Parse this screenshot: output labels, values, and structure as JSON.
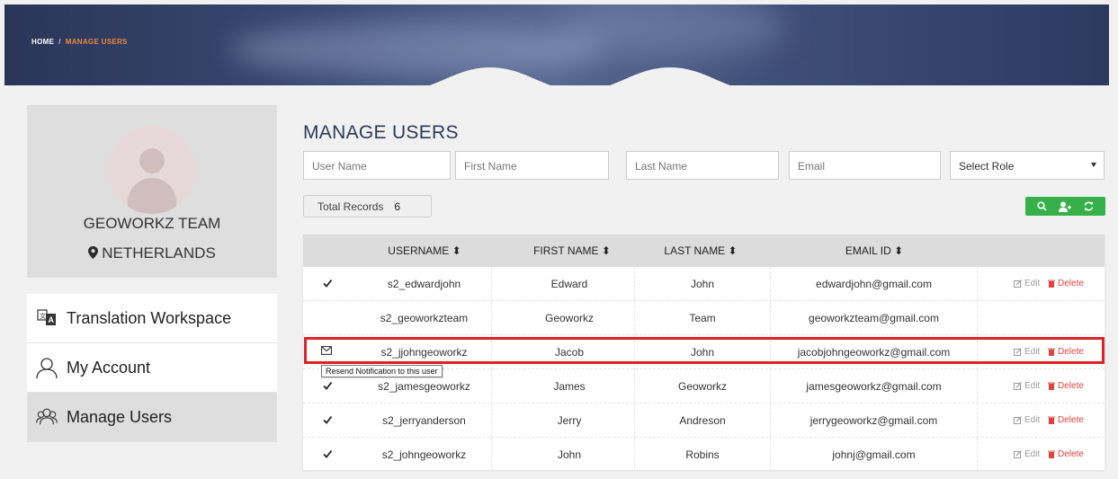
{
  "breadcrumb": {
    "home": "HOME",
    "separator": "/",
    "current": "MANAGE USERS"
  },
  "profile": {
    "name": "GEOWORKZ TEAM",
    "location": "NETHERLANDS"
  },
  "sidebar": {
    "items": [
      {
        "label": "Translation Workspace",
        "icon": "translate-icon",
        "active": false
      },
      {
        "label": "My Account",
        "icon": "user-icon",
        "active": false
      },
      {
        "label": "Manage Users",
        "icon": "users-icon",
        "active": true
      }
    ]
  },
  "page": {
    "title": "MANAGE USERS"
  },
  "filters": {
    "username_placeholder": "User Name",
    "firstname_placeholder": "First Name",
    "lastname_placeholder": "Last Name",
    "email_placeholder": "Email",
    "role_selected": "Select Role"
  },
  "records": {
    "label": "Total Records",
    "count": "6"
  },
  "colors": {
    "accent_green": "#36b04a",
    "delete_red": "#e0443c",
    "highlight_red": "#e01f26",
    "breadcrumb_orange": "#e98a3c"
  },
  "table": {
    "headers": {
      "username": "USERNAME",
      "first_name": "FIRST NAME",
      "last_name": "LAST NAME",
      "email": "EMAIL ID"
    },
    "edit_label": "Edit",
    "delete_label": "Delete",
    "rows": [
      {
        "status": "check",
        "username": "s2_edwardjohn",
        "first_name": "Edward",
        "last_name": "John",
        "email": "edwardjohn@gmail.com",
        "actions": true
      },
      {
        "status": "none",
        "username": "s2_geoworkzteam",
        "first_name": "Geoworkz",
        "last_name": "Team",
        "email": "geoworkzteam@gmail.com",
        "actions": false
      },
      {
        "status": "envelope",
        "username": "s2_jjohngeoworkz",
        "first_name": "Jacob",
        "last_name": "John",
        "email": "jacobjohngeoworkz@gmail.com",
        "actions": true
      },
      {
        "status": "check",
        "username": "s2_jamesgeoworkz",
        "first_name": "James",
        "last_name": "Geoworkz",
        "email": "jamesgeoworkz@gmail.com",
        "actions": true
      },
      {
        "status": "check",
        "username": "s2_jerryanderson",
        "first_name": "Jerry",
        "last_name": "Andreson",
        "email": "jerrygeoworkz@gmail.com",
        "actions": true
      },
      {
        "status": "check",
        "username": "s2_johngeoworkz",
        "first_name": "John",
        "last_name": "Robins",
        "email": "johnj@gmail.com",
        "actions": true
      }
    ]
  },
  "tooltip": {
    "text": "Resend Notification to this user"
  }
}
